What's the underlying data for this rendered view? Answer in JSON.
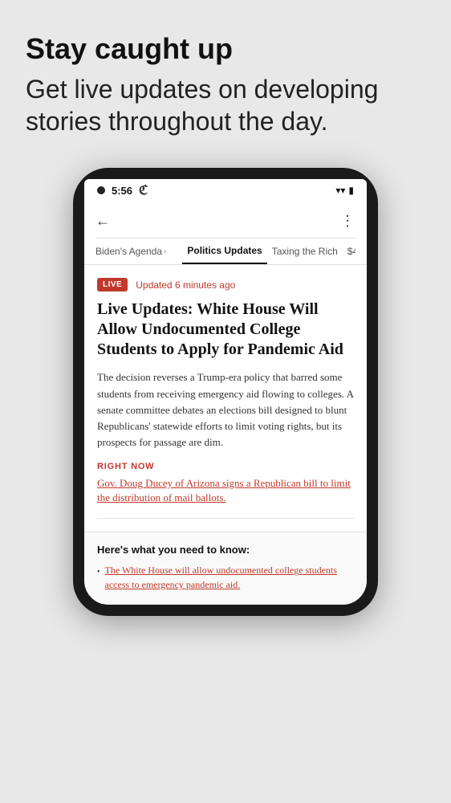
{
  "hero": {
    "title": "Stay caught up",
    "subtitle": "Get live updates on developing stories throughout the day."
  },
  "phone": {
    "status": {
      "time": "5:56",
      "logo": "ℭ"
    },
    "nav": {
      "back_label": "←",
      "more_label": "⋮"
    },
    "tabs": [
      {
        "label": "Biden's Agenda",
        "active": false,
        "has_arrow": true
      },
      {
        "label": "Politics Updates",
        "active": true
      },
      {
        "label": "Taxing the Rich",
        "active": false
      },
      {
        "label": "$4",
        "active": false
      }
    ],
    "article": {
      "live_badge": "LIVE",
      "updated_text": "Updated 6 minutes ago",
      "headline": "Live Updates: White House Will Allow Undocumented College Students to Apply for Pandemic Aid",
      "body": "The decision reverses a Trump-era policy that barred some students from receiving emergency aid flowing to colleges. A senate committee debates an elections bill designed to blunt Republicans' statewide efforts to limit voting rights, but its prospects for passage are dim.",
      "right_now_label": "RIGHT NOW",
      "right_now_text": "Gov. Doug Ducey of Arizona signs a Republican bill to limit the distribution of mail ballots."
    },
    "explainer": {
      "title": "Here's what you need to know:",
      "bullet": "The White House will allow undocumented college students access to emergency pandemic aid."
    }
  }
}
